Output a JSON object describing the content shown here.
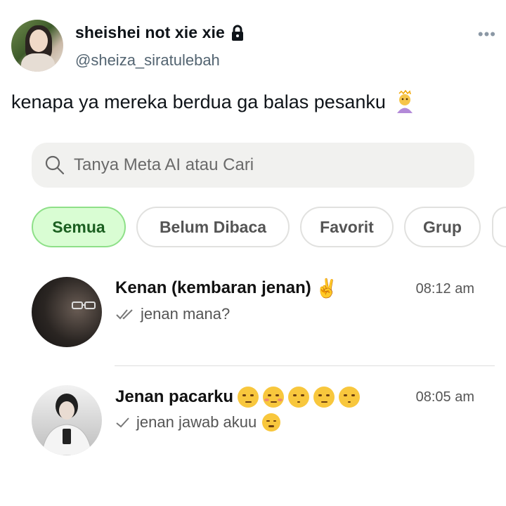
{
  "tweet": {
    "display_name": "sheishei not xie xie",
    "lock_icon": "lock-icon",
    "handle": "@sheiza_siratulebah",
    "more_icon": "more-icon",
    "text": "kenapa ya mereka berdua ga balas pesanku"
  },
  "whatsapp": {
    "search_placeholder": "Tanya Meta AI atau Cari",
    "filters": [
      "Semua",
      "Belum Dibaca",
      "Favorit",
      "Grup"
    ],
    "active_filter": "Semua",
    "chats": [
      {
        "name": "Kenan (kembaran jenan)",
        "time": "08:12 am",
        "status": "read",
        "message": "jenan mana?"
      },
      {
        "name": "Jenan pacarku",
        "time": "08:05 am",
        "status": "sent",
        "message": "jenan jawab akuu"
      }
    ]
  },
  "colors": {
    "accent_green": "#d9fdd3",
    "accent_green_border": "#8ee088",
    "text_gray": "#536471"
  }
}
